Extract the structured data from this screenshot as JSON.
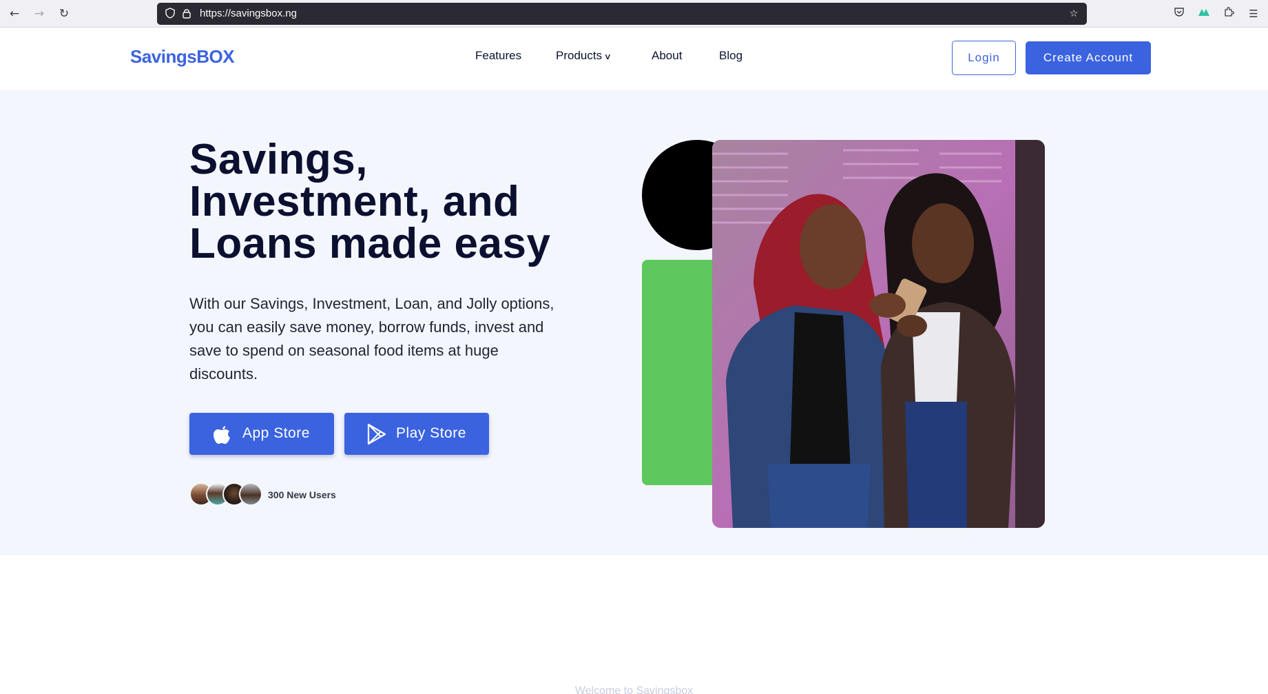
{
  "browser": {
    "url": "https://savingsbox.ng",
    "icons": [
      "back-arrow-icon",
      "forward-arrow-icon",
      "reload-icon",
      "shield-icon",
      "lock-icon",
      "star-icon",
      "pocket-icon",
      "vpn-icon",
      "extensions-icon",
      "menu-icon"
    ]
  },
  "header": {
    "logo": "SavingsBOX",
    "nav": {
      "features": "Features",
      "products": "Products",
      "about": "About",
      "blog": "Blog"
    },
    "login": "Login",
    "create_account": "Create Account"
  },
  "hero": {
    "title": "Savings, Investment, and Loans made easy",
    "description": "With our Savings, Investment, Loan, and Jolly options, you can easily save money, borrow funds, invest and save to spend on seasonal food items at huge discounts.",
    "app_store": "App Store",
    "play_store": "Play Store",
    "new_users": "300 New Users"
  },
  "below": {
    "faded_heading": "Welcome to Savingsbox"
  },
  "colors": {
    "brand_blue": "#3b63e0",
    "dark_text": "#0b1030",
    "hero_bg": "#f4f6fd",
    "accent_green": "#5ec85e"
  }
}
